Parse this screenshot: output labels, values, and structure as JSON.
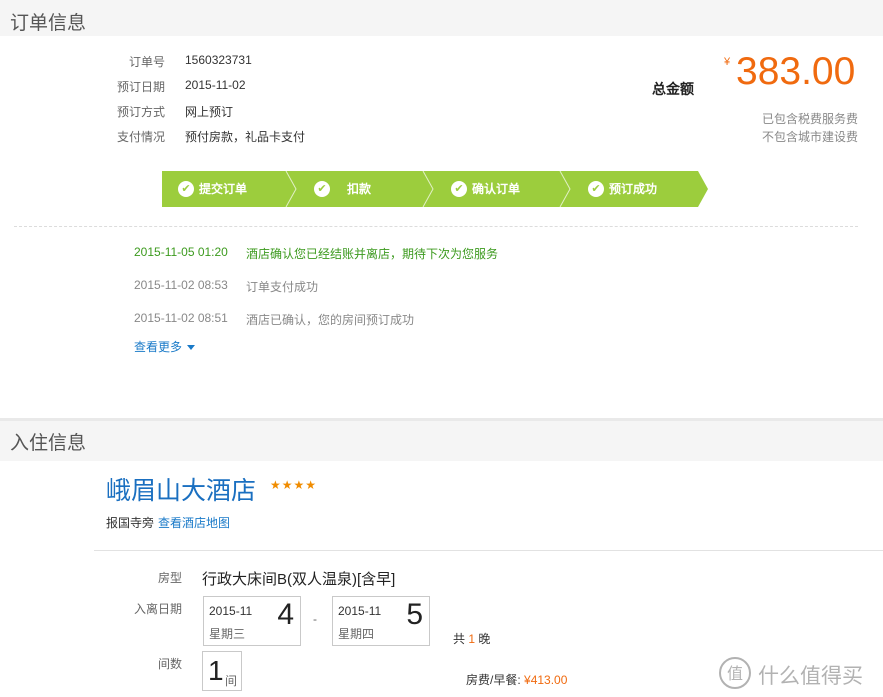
{
  "order_section": {
    "title": "订单信息",
    "fields": [
      {
        "label": "订单号",
        "value": "1560323731"
      },
      {
        "label": "预订日期",
        "value": "2015-11-02"
      },
      {
        "label": "预订方式",
        "value": "网上预订"
      },
      {
        "label": "支付情况",
        "value": "预付房款，礼品卡支付"
      }
    ],
    "total": {
      "label": "总金额",
      "currency": "¥",
      "amount": "383.00",
      "note1": "已包含税费服务费",
      "note2": "不包含城市建设费"
    },
    "progress": {
      "steps": [
        "提交订单",
        "扣款",
        "确认订单",
        "预订成功"
      ],
      "check_glyph": "✔",
      "color": "#9ccd3d"
    },
    "log": [
      {
        "time": "2015-11-05 01:20",
        "text": "酒店确认您已经结账并离店，期待下次为您服务"
      },
      {
        "time": "2015-11-02 08:53",
        "text": "订单支付成功"
      },
      {
        "time": "2015-11-02 08:51",
        "text": "酒店已确认，您的房间预订成功"
      }
    ],
    "more_link": "查看更多"
  },
  "checkin_section": {
    "title": "入住信息",
    "hotel_name": "峨眉山大酒店",
    "stars": "★★★★",
    "address": "报国寺旁",
    "map_link": "查看酒店地图",
    "room_type_label": "房型",
    "room_type": "行政大床间B(双人温泉)[含早]",
    "dates_label": "入离日期",
    "checkin": {
      "ym": "2015-11",
      "weekday": "星期三",
      "day": "4"
    },
    "separator": "-",
    "checkout": {
      "ym": "2015-11",
      "weekday": "星期四",
      "day": "5"
    },
    "nights_prefix": "共",
    "nights": "1",
    "nights_suffix": "晚",
    "rooms_label": "间数",
    "rooms": "1",
    "rooms_unit": "间",
    "price_label": "房费/早餐:",
    "price_currency": "¥",
    "price": "413.00"
  },
  "watermark": {
    "text": "什么值得买",
    "icon": "zhi-logo-icon"
  },
  "colors": {
    "accent_orange": "#f06a0f",
    "link_blue": "#1a7ac8",
    "progress_green": "#9ccd3d",
    "log_green": "#3c9a1e"
  }
}
